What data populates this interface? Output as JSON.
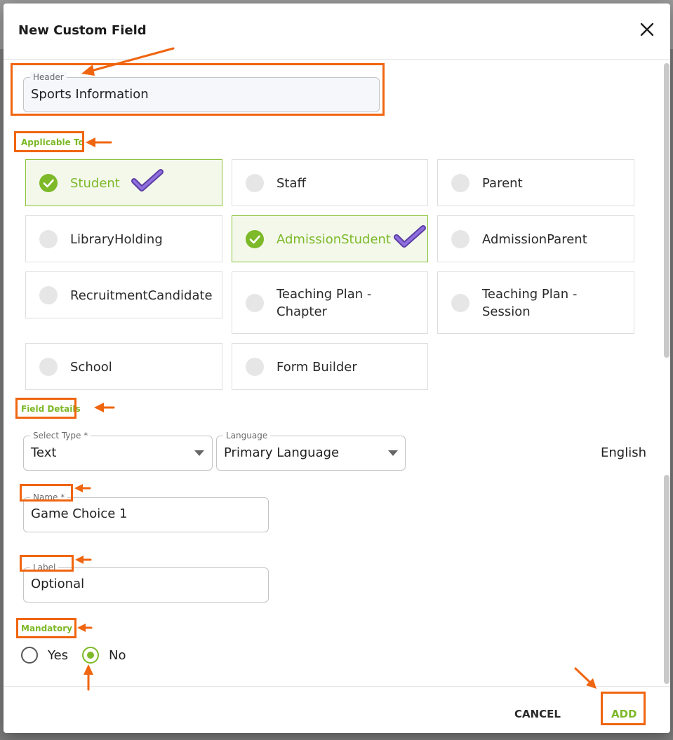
{
  "dialog": {
    "title": "New Custom Field"
  },
  "header_field": {
    "label": "Header",
    "value": "Sports Information"
  },
  "applicable": {
    "label": "Applicable To",
    "options": [
      {
        "label": "Student",
        "selected": true
      },
      {
        "label": "Staff",
        "selected": false
      },
      {
        "label": "Parent",
        "selected": false
      },
      {
        "label": "LibraryHolding",
        "selected": false
      },
      {
        "label": "AdmissionStudent",
        "selected": true
      },
      {
        "label": "AdmissionParent",
        "selected": false
      },
      {
        "label": "RecruitmentCandidate",
        "selected": false
      },
      {
        "label": "Teaching Plan - Chapter",
        "selected": false
      },
      {
        "label": "Teaching Plan - Session",
        "selected": false
      },
      {
        "label": "School",
        "selected": false
      },
      {
        "label": "Form Builder",
        "selected": false
      }
    ]
  },
  "field_details": {
    "label": "Field Details",
    "select_type": {
      "label": "Select Type *",
      "value": "Text"
    },
    "language": {
      "label": "Language",
      "value": "Primary Language"
    },
    "language_name": "English",
    "name": {
      "label": "Name *",
      "value": "Game Choice 1"
    },
    "label_field": {
      "label": "Label",
      "value": "Optional"
    }
  },
  "mandatory": {
    "label": "Mandatory",
    "options": [
      {
        "label": "Yes",
        "selected": false
      },
      {
        "label": "No",
        "selected": true
      }
    ]
  },
  "footer": {
    "cancel": "CANCEL",
    "add": "ADD"
  },
  "colors": {
    "accent": "#7db928",
    "annotation": "#f0650f",
    "check_mark": "#7b54c9"
  }
}
